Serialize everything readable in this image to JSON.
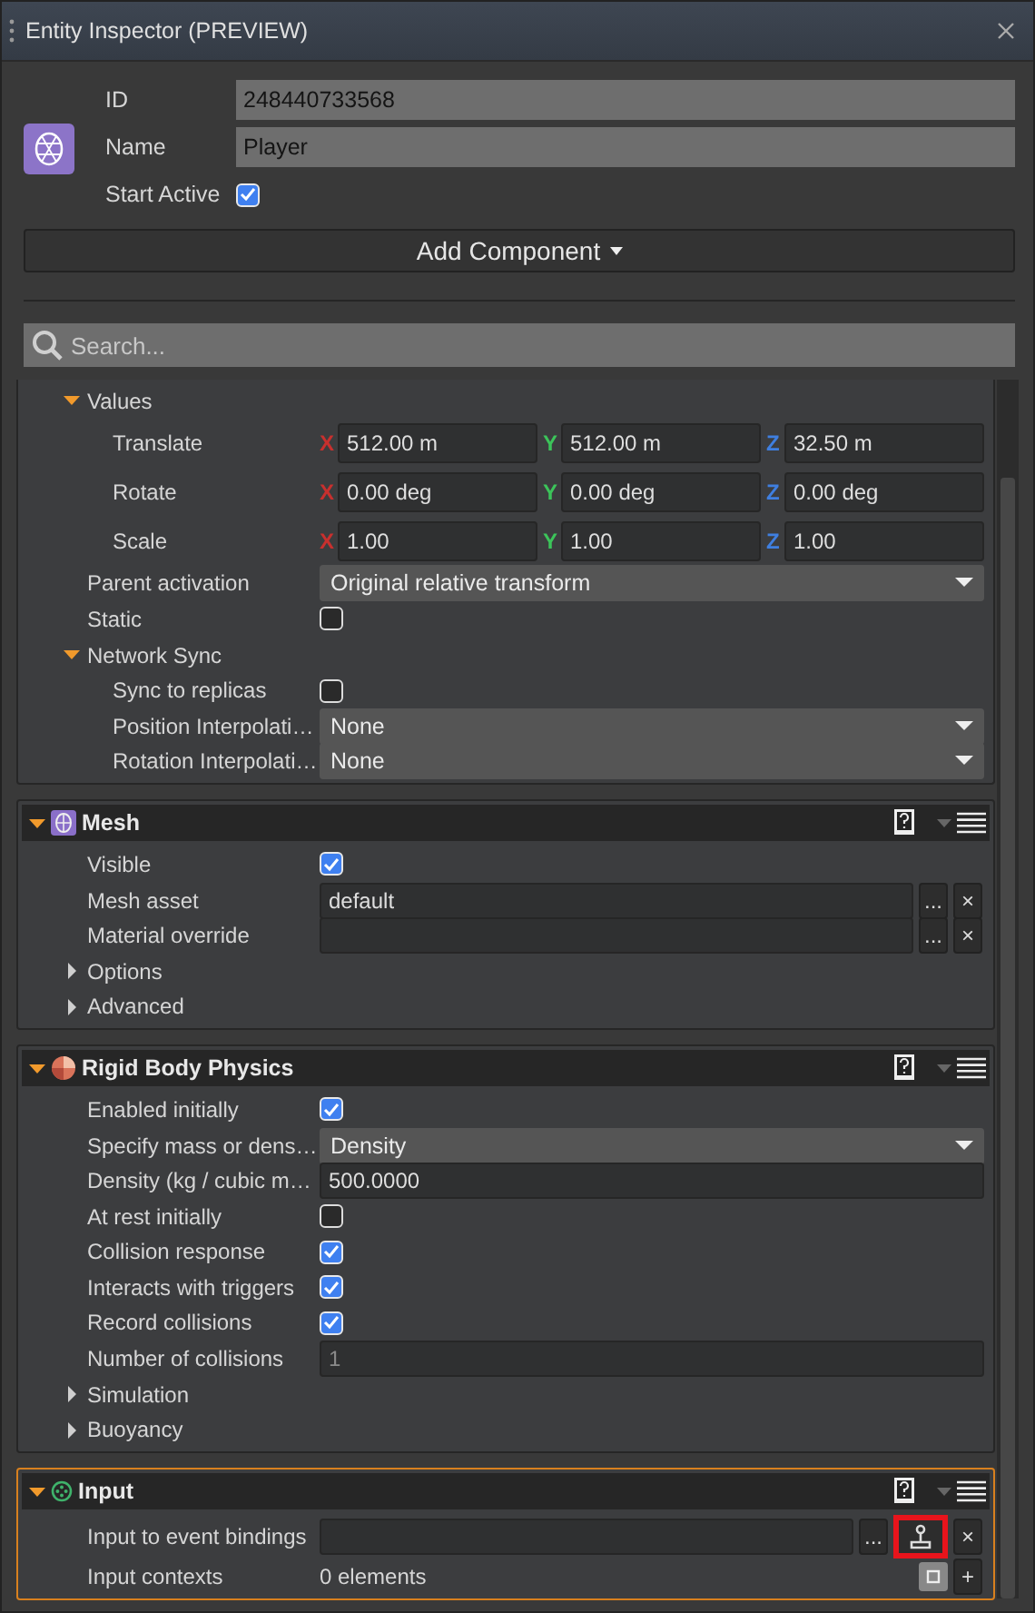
{
  "window": {
    "title": "Entity Inspector (PREVIEW)"
  },
  "entity": {
    "fields": [
      {
        "label": "ID",
        "value": "248440733568"
      },
      {
        "label": "Name",
        "value": "Player"
      }
    ],
    "start_active": {
      "label": "Start Active",
      "checked": true
    }
  },
  "add_component": {
    "label": "Add Component"
  },
  "search": {
    "placeholder": "Search..."
  },
  "transform": {
    "rows": [
      {
        "kind": "group",
        "label": "Values",
        "expanded": true,
        "children": [
          {
            "kind": "vector",
            "label": "Translate",
            "components": [
              {
                "axis": "X",
                "color": "#c8302e",
                "value": "512.00 m"
              },
              {
                "axis": "Y",
                "color": "#3cc45a",
                "value": "512.00 m"
              },
              {
                "axis": "Z",
                "color": "#3f7fe0",
                "value": "32.50 m"
              }
            ]
          },
          {
            "kind": "vector",
            "label": "Rotate",
            "components": [
              {
                "axis": "X",
                "color": "#c8302e",
                "value": "0.00 deg"
              },
              {
                "axis": "Y",
                "color": "#3cc45a",
                "value": "0.00 deg"
              },
              {
                "axis": "Z",
                "color": "#3f7fe0",
                "value": "0.00 deg"
              }
            ]
          },
          {
            "kind": "vector",
            "label": "Scale",
            "components": [
              {
                "axis": "X",
                "color": "#c8302e",
                "value": "1.00"
              },
              {
                "axis": "Y",
                "color": "#3cc45a",
                "value": "1.00"
              },
              {
                "axis": "Z",
                "color": "#3f7fe0",
                "value": "1.00"
              }
            ]
          }
        ]
      },
      {
        "kind": "dropdown",
        "label": "Parent activation",
        "value": "Original relative transform"
      },
      {
        "kind": "checkbox",
        "label": "Static",
        "checked": false
      },
      {
        "kind": "group",
        "label": "Network Sync",
        "expanded": true,
        "children": [
          {
            "kind": "checkbox",
            "label": "Sync to replicas",
            "checked": false
          },
          {
            "kind": "dropdown",
            "label": "Position Interpolati…",
            "value": "None"
          },
          {
            "kind": "dropdown",
            "label": "Rotation Interpolati…",
            "value": "None"
          }
        ]
      }
    ]
  },
  "components": [
    {
      "kind": "mesh",
      "title": "Mesh",
      "focused": false,
      "rows": [
        {
          "kind": "checkbox",
          "label": "Visible",
          "checked": true
        },
        {
          "kind": "asset",
          "label": "Mesh asset",
          "value": "default",
          "browse": "...",
          "clear": "×"
        },
        {
          "kind": "asset",
          "label": "Material override",
          "browse": "...",
          "clear": "×"
        },
        {
          "kind": "group",
          "label": "Options",
          "expanded": false
        },
        {
          "kind": "group",
          "label": "Advanced",
          "expanded": false
        }
      ]
    },
    {
      "kind": "physics",
      "title": "Rigid Body Physics",
      "focused": false,
      "rows": [
        {
          "kind": "checkbox",
          "label": "Enabled initially",
          "checked": true
        },
        {
          "kind": "dropdown",
          "label": "Specify mass or dens…",
          "value": "Density"
        },
        {
          "kind": "text",
          "label": "Density (kg / cubic m…",
          "value": "500.0000",
          "disabled": false
        },
        {
          "kind": "checkbox",
          "label": "At rest initially",
          "checked": false
        },
        {
          "kind": "checkbox",
          "label": "Collision response",
          "checked": true
        },
        {
          "kind": "checkbox",
          "label": "Interacts with triggers",
          "checked": true
        },
        {
          "kind": "checkbox",
          "label": "Record collisions",
          "checked": true
        },
        {
          "kind": "text",
          "label": "Number of collisions",
          "value": "1",
          "disabled": true
        },
        {
          "kind": "group",
          "label": "Simulation",
          "expanded": false
        },
        {
          "kind": "group",
          "label": "Buoyancy",
          "expanded": false
        }
      ]
    },
    {
      "kind": "input",
      "title": "Input",
      "focused": true,
      "rows": [
        {
          "kind": "binding",
          "label": "Input to event bindings",
          "browse": "...",
          "highlighted": true,
          "clear": "×"
        },
        {
          "kind": "container",
          "label": "Input contexts",
          "value": "0 elements",
          "add": "+"
        }
      ]
    }
  ]
}
